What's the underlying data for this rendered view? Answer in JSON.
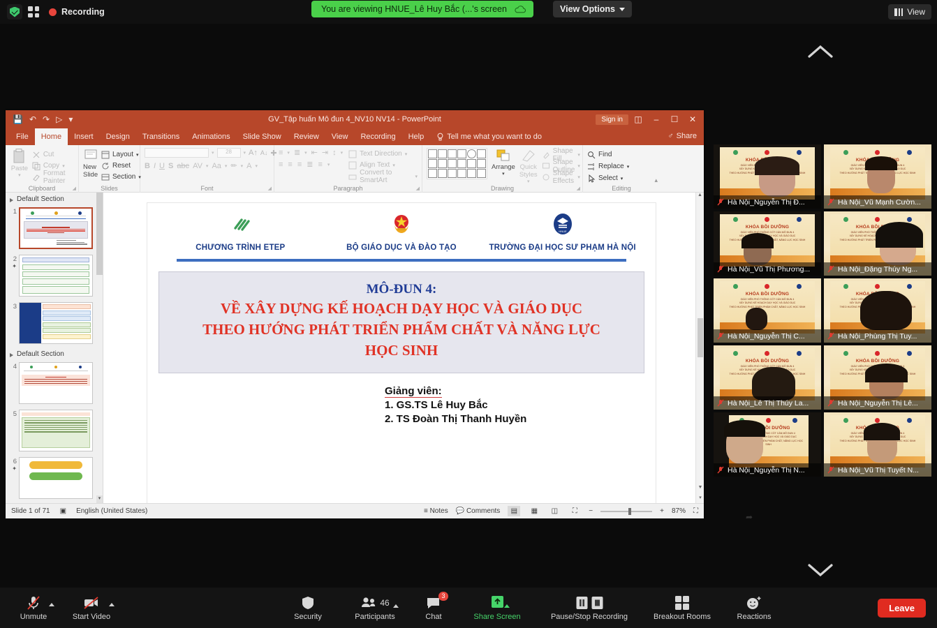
{
  "zoom_topbar": {
    "security_icon": "shield-check-icon",
    "gallery_icon": "grid-view-icon",
    "recording_label": "Recording",
    "viewing_banner": "You are viewing HNUE_Lê Huy Bắc (...'s screen",
    "cloud_icon": "cloud-recording-icon",
    "view_options_label": "View Options",
    "view_button_label": "View"
  },
  "powerpoint": {
    "title": "GV_Tập huấn Mô đun 4_NV10 NV14  -  PowerPoint",
    "quick_access": [
      "save-icon",
      "undo-icon",
      "redo-icon",
      "start-slideshow-icon",
      "customize-qat-icon"
    ],
    "signin_label": "Sign in",
    "window_buttons": [
      "ribbon-display-options",
      "minimize",
      "restore",
      "close"
    ],
    "tabs": [
      {
        "label": "File",
        "active": false
      },
      {
        "label": "Home",
        "active": true
      },
      {
        "label": "Insert",
        "active": false
      },
      {
        "label": "Design",
        "active": false
      },
      {
        "label": "Transitions",
        "active": false
      },
      {
        "label": "Animations",
        "active": false
      },
      {
        "label": "Slide Show",
        "active": false
      },
      {
        "label": "Review",
        "active": false
      },
      {
        "label": "View",
        "active": false
      },
      {
        "label": "Recording",
        "active": false
      },
      {
        "label": "Help",
        "active": false
      }
    ],
    "tell_me": "Tell me what you want to do",
    "share_label": "Share",
    "ribbon": {
      "clipboard": {
        "group": "Clipboard",
        "paste": "Paste",
        "items": [
          "Cut",
          "Copy",
          "Format Painter"
        ]
      },
      "slides": {
        "group": "Slides",
        "new_slide": "New Slide",
        "items": [
          "Layout",
          "Reset",
          "Section"
        ]
      },
      "font": {
        "group": "Font",
        "font_name": "",
        "font_size": "28"
      },
      "paragraph": {
        "group": "Paragraph",
        "items": [
          "Text Direction",
          "Align Text",
          "Convert to SmartArt"
        ]
      },
      "drawing": {
        "group": "Drawing",
        "arrange": "Arrange",
        "quick_styles": "Quick Styles",
        "items": [
          "Shape Fill",
          "Shape Outline",
          "Shape Effects"
        ]
      },
      "editing": {
        "group": "Editing",
        "items": [
          "Find",
          "Replace",
          "Select"
        ]
      }
    },
    "slide_pane": {
      "sections": [
        {
          "name": "Default Section",
          "slides": [
            {
              "number": "1",
              "selected": true,
              "starred": false
            },
            {
              "number": "2",
              "selected": false,
              "starred": true
            },
            {
              "number": "3",
              "selected": false,
              "starred": false
            }
          ]
        },
        {
          "name": "Default Section",
          "slides": [
            {
              "number": "4",
              "selected": false,
              "starred": false
            },
            {
              "number": "5",
              "selected": false,
              "starred": false
            },
            {
              "number": "6",
              "selected": false,
              "starred": true
            }
          ]
        }
      ]
    },
    "slide": {
      "logos": [
        {
          "caption": "CHƯƠNG TRÌNH ETEP",
          "icon": "etep-logo"
        },
        {
          "caption": "BỘ GIÁO DỤC VÀ ĐÀO TẠO",
          "icon": "vietnam-emblem-logo"
        },
        {
          "caption": "TRƯỜNG ĐẠI HỌC SƯ PHẠM HÀ NỘI",
          "icon": "hnue-logo"
        }
      ],
      "title_line1": "MÔ-ĐUN 4:",
      "title_line2": "VỀ XÂY DỰNG KẾ HOẠCH DẠY HỌC VÀ GIÁO DỤC",
      "title_line3": "THEO HƯỚNG PHÁT TRIỂN PHẨM CHẤT VÀ NĂNG LỰC",
      "title_line4": "HỌC SINH",
      "lecturer_label": "Giảng viên:",
      "lecturer_1": "1. GS.TS Lê Huy Bắc",
      "lecturer_2": "2. TS Đoàn Thị Thanh Huyền"
    },
    "status_bar": {
      "slide_count": "Slide 1 of 71",
      "accessibility_icon": "accessibility-icon",
      "language": "English (United States)",
      "notes_label": "Notes",
      "comments_label": "Comments",
      "views": [
        "normal-view",
        "slide-sorter-view",
        "reading-view",
        "slideshow-view"
      ],
      "zoom_out": "−",
      "zoom_in": "+",
      "zoom_level": "87%",
      "fit_icon": "fit-slide-to-window-icon"
    }
  },
  "participants": [
    {
      "name": "Hà Nội_Nguyễn Thị Đ...",
      "muted": true
    },
    {
      "name": "Hà Nội_Vũ Mạnh Cườn...",
      "muted": true
    },
    {
      "name": "Hà Nội_Vũ Thị Phương...",
      "muted": true
    },
    {
      "name": "Hà Nội_Đặng Thúy Ng...",
      "muted": true
    },
    {
      "name": "Hà Nội_Nguyễn Thị C...",
      "muted": true
    },
    {
      "name": "Hà Nội_Phùng Thị Tuy...",
      "muted": true
    },
    {
      "name": "Hà Nội_Lê Thị Thúy La...",
      "muted": true
    },
    {
      "name": "Hà Nội_Nguyễn Thị Lê...",
      "muted": true
    },
    {
      "name": "Hà Nội_Nguyễn Thị N...",
      "muted": true
    },
    {
      "name": "Hà Nội_Vũ Thị Tuyết N...",
      "muted": true
    }
  ],
  "toolbar": {
    "unmute_label": "Unmute",
    "start_video_label": "Start Video",
    "security_label": "Security",
    "participants_label": "Participants",
    "participants_count": "46",
    "chat_label": "Chat",
    "chat_badge": "3",
    "share_screen_label": "Share Screen",
    "recording_label": "Pause/Stop Recording",
    "breakout_label": "Breakout Rooms",
    "reactions_label": "Reactions",
    "leave_label": "Leave"
  },
  "colors": {
    "ppt_accent": "#b7472a",
    "zoom_green": "#4ad04a",
    "leave_red": "#e02b20",
    "title_red": "#e03326",
    "title_blue": "#203c96",
    "rule_blue": "#3d6ec0"
  }
}
